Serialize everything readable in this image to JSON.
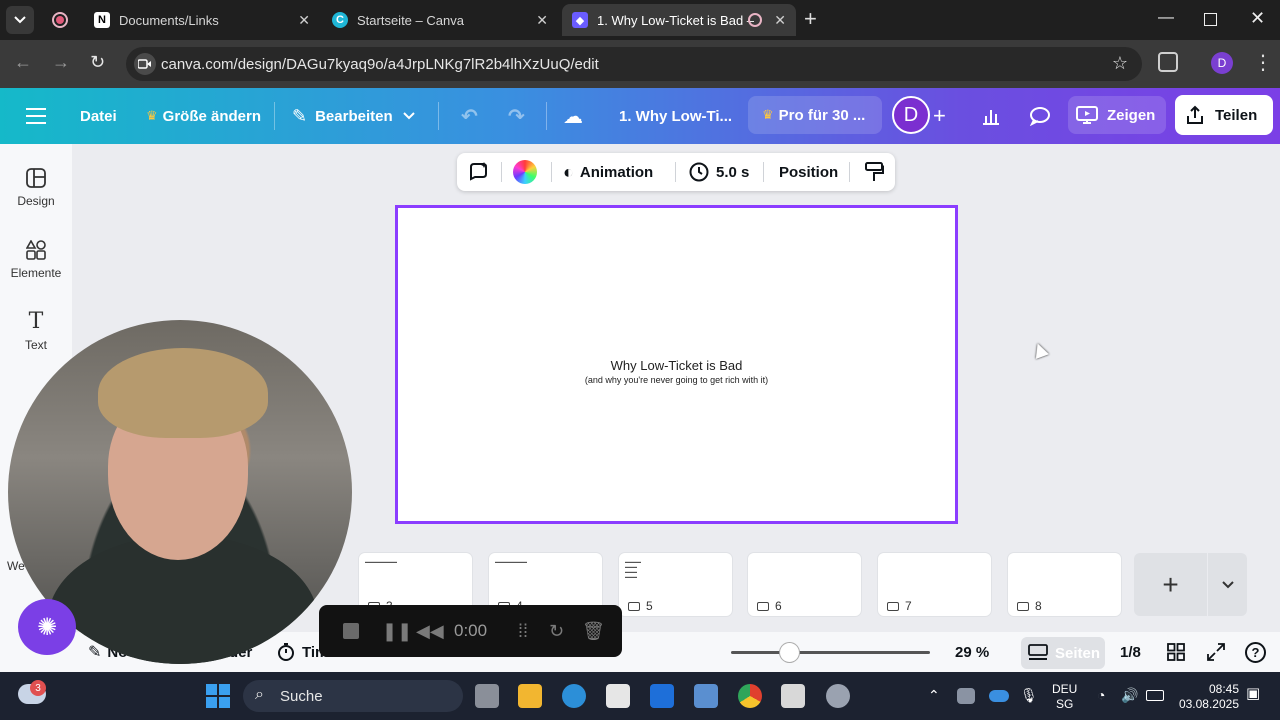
{
  "browser": {
    "tabs": [
      {
        "title": "Documents/Links",
        "icon": "notion-icon"
      },
      {
        "title": "Startseite – Canva",
        "icon": "canva-icon"
      },
      {
        "title": "1. Why Low-Ticket is Bad – ",
        "icon": "canva-shield-icon",
        "active": true
      }
    ],
    "url": "canva.com/design/DAGu7kyaq9o/a4JrpLNKg7lR2b4lhXzUuQ/edit"
  },
  "canva_topbar": {
    "file": "Datei",
    "resize": "Größe ändern",
    "edit": "Bearbeiten",
    "doc_title": "1. Why Low-Ti...",
    "pro": "Pro für 30 ...",
    "avatar": "D",
    "present": "Zeigen",
    "share": "Teilen"
  },
  "sidebar": {
    "items": [
      {
        "label": "Design",
        "icon": "design-icon"
      },
      {
        "label": "Elemente",
        "icon": "elements-icon"
      },
      {
        "label": "Text",
        "icon": "text-icon"
      }
    ],
    "partial_label": "We"
  },
  "context_toolbar": {
    "animation": "Animation",
    "duration": "5.0 s",
    "position": "Position"
  },
  "slide": {
    "title": "Why Low-Ticket is Bad",
    "subtitle": "(and why you're never going to get rich with it)"
  },
  "pages": [
    {
      "num": "3"
    },
    {
      "num": "4"
    },
    {
      "num": "5"
    },
    {
      "num": "6"
    },
    {
      "num": "7"
    },
    {
      "num": "8"
    }
  ],
  "bottom_bar": {
    "notes": "No",
    "timer_partial": "der",
    "timer": "Timer",
    "zoom": "29 %",
    "zoom_level": 0.29,
    "pages_label": "Seiten",
    "page_count": "1/8"
  },
  "recorder": {
    "time": "0:00"
  },
  "taskbar": {
    "search": "Suche",
    "weather_badge": "3",
    "lang": "DEU",
    "region": "SG",
    "time": "08:45",
    "date": "03.08.2025"
  },
  "colors": {
    "accent": "#8b3dff",
    "gradient_start": "#15b9c9",
    "gradient_end": "#7b3fe6"
  }
}
